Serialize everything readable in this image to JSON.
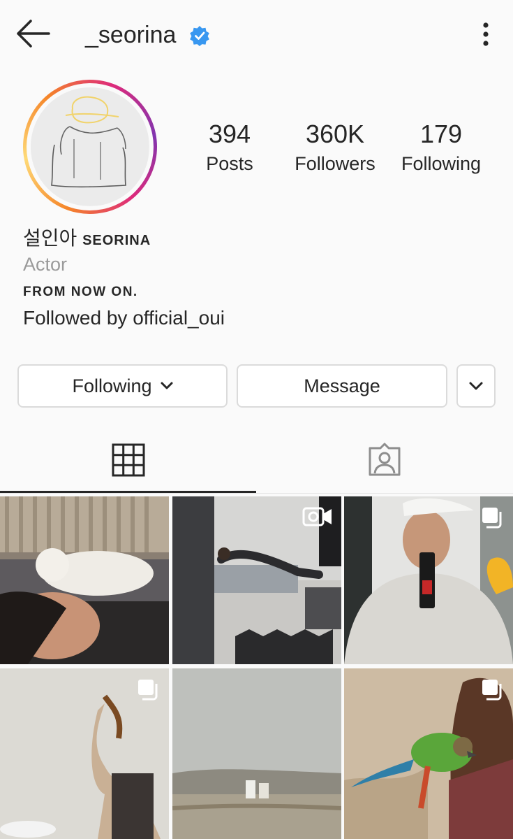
{
  "header": {
    "username": "_seorina",
    "back_icon": "arrow-left-icon",
    "verified_icon": "verified-badge-icon",
    "more_icon": "more-vertical-icon"
  },
  "stats": {
    "posts": {
      "value": "394",
      "label": "Posts"
    },
    "followers": {
      "value": "360K",
      "label": "Followers"
    },
    "following": {
      "value": "179",
      "label": "Following"
    }
  },
  "profile": {
    "name_kr": "설인아",
    "name_en": "SEORINA",
    "category": "Actor",
    "bio": "FROM NOW ON.",
    "followed_by_prefix": "Followed by",
    "followed_by_user": "official_oui"
  },
  "buttons": {
    "following_label": "Following",
    "message_label": "Message"
  },
  "tabs": [
    {
      "name": "grid",
      "icon": "grid-icon",
      "active": true
    },
    {
      "name": "tagged",
      "icon": "tagged-person-icon",
      "active": false
    }
  ],
  "grid": [
    {
      "badge": null,
      "desc": "photo"
    },
    {
      "badge": "video-icon",
      "desc": "video"
    },
    {
      "badge": "carousel-icon",
      "desc": "album"
    },
    {
      "badge": "carousel-icon",
      "desc": "album"
    },
    {
      "badge": null,
      "desc": "photo"
    },
    {
      "badge": "carousel-icon",
      "desc": "album"
    }
  ],
  "colors": {
    "verified": "#3897f0",
    "text": "#262626",
    "secondary": "#9a9a9a",
    "border": "#dbdbdb"
  }
}
